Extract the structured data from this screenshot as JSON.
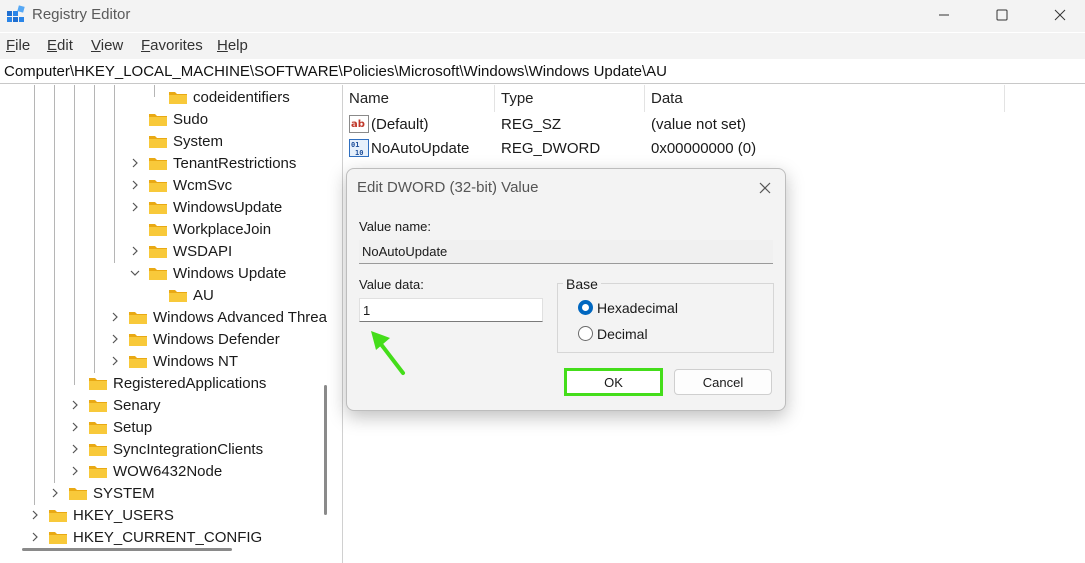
{
  "window": {
    "title": "Registry Editor",
    "controls": {
      "minimize": "minimize-icon",
      "maximize": "maximize-icon",
      "close": "close-icon"
    }
  },
  "menu": {
    "items": [
      {
        "first": "F",
        "rest": "ile"
      },
      {
        "first": "E",
        "rest": "dit"
      },
      {
        "first": "V",
        "rest": "iew"
      },
      {
        "first": "F",
        "rest": "avorites"
      },
      {
        "first": "H",
        "rest": "elp"
      }
    ]
  },
  "address": {
    "path": "Computer\\HKEY_LOCAL_MACHINE\\SOFTWARE\\Policies\\Microsoft\\Windows\\Windows Update\\AU"
  },
  "tree": {
    "items": [
      {
        "label": "codeidentifiers",
        "expander": "none"
      },
      {
        "label": "Sudo",
        "expander": "none"
      },
      {
        "label": "System",
        "expander": "none"
      },
      {
        "label": "TenantRestrictions",
        "expander": "collapsed"
      },
      {
        "label": "WcmSvc",
        "expander": "collapsed"
      },
      {
        "label": "WindowsUpdate",
        "expander": "collapsed"
      },
      {
        "label": "WorkplaceJoin",
        "expander": "none"
      },
      {
        "label": "WSDAPI",
        "expander": "collapsed"
      },
      {
        "label": "Windows Update",
        "expander": "expanded"
      },
      {
        "label": "AU",
        "expander": "none",
        "selected": true
      },
      {
        "label": "Windows Advanced Threa",
        "expander": "collapsed"
      },
      {
        "label": "Windows Defender",
        "expander": "collapsed"
      },
      {
        "label": "Windows NT",
        "expander": "collapsed"
      },
      {
        "label": "RegisteredApplications",
        "expander": "none"
      },
      {
        "label": "Senary",
        "expander": "collapsed"
      },
      {
        "label": "Setup",
        "expander": "collapsed"
      },
      {
        "label": "SyncIntegrationClients",
        "expander": "collapsed"
      },
      {
        "label": "WOW6432Node",
        "expander": "collapsed"
      },
      {
        "label": "SYSTEM",
        "expander": "collapsed"
      },
      {
        "label": "HKEY_USERS",
        "expander": "collapsed"
      },
      {
        "label": "HKEY_CURRENT_CONFIG",
        "expander": "collapsed"
      }
    ]
  },
  "list": {
    "columns": [
      "Name",
      "Type",
      "Data"
    ],
    "rows": [
      {
        "name": "(Default)",
        "type": "REG_SZ",
        "data": "(value not set)",
        "icon": "string-value-icon"
      },
      {
        "name": "NoAutoUpdate",
        "type": "REG_DWORD",
        "data": "0x00000000 (0)",
        "icon": "dword-value-icon"
      }
    ]
  },
  "dialog": {
    "title": "Edit DWORD (32-bit) Value",
    "value_name_label": "Value name:",
    "value_name": "NoAutoUpdate",
    "value_data_label": "Value data:",
    "value_data": "1",
    "base_label": "Base",
    "base_options": [
      {
        "label": "Hexadecimal",
        "selected": true
      },
      {
        "label": "Decimal",
        "selected": false
      }
    ],
    "ok_label": "OK",
    "cancel_label": "Cancel"
  },
  "colors": {
    "highlight_green": "#44dd1a",
    "folder_yellow": "#f8c93a",
    "radio_blue": "#0067c0"
  }
}
